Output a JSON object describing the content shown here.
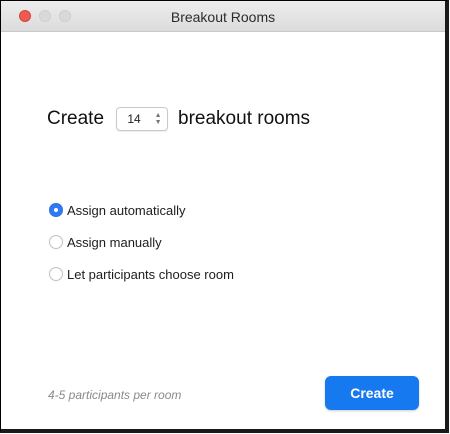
{
  "window": {
    "title": "Breakout Rooms"
  },
  "create_row": {
    "prefix": "Create",
    "room_count": "14",
    "suffix": "breakout rooms"
  },
  "assignment_options": [
    {
      "label": "Assign automatically",
      "selected": true
    },
    {
      "label": "Assign manually",
      "selected": false
    },
    {
      "label": "Let participants choose room",
      "selected": false
    }
  ],
  "footer": {
    "note": "4-5 participants per room",
    "create_label": "Create"
  },
  "colors": {
    "accent": "#1679f0",
    "close_button": "#ef5b52"
  }
}
